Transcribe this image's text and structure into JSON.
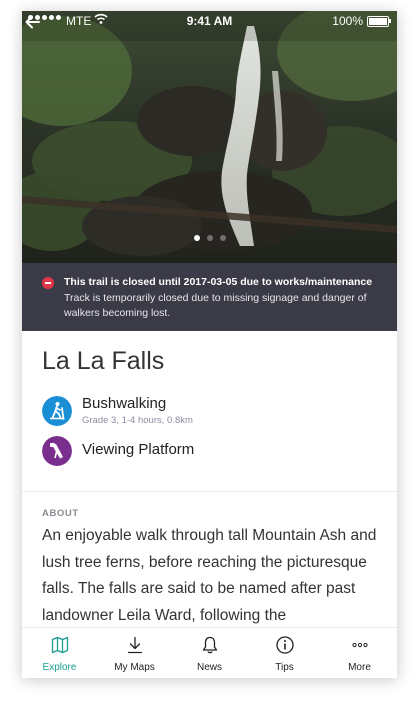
{
  "status_bar": {
    "carrier": "MTE",
    "time": "9:41 AM",
    "battery": "100%"
  },
  "hero": {
    "slide_count": 3,
    "active_slide": 1
  },
  "alert": {
    "title": "This trail is closed until 2017-03-05 due to works/maintenance",
    "body": "Track is temporarily closed due to missing signage and danger of walkers becoming lost.",
    "color": "#e0364a"
  },
  "place": {
    "title": "La La Falls"
  },
  "activities": [
    {
      "name": "Bushwalking",
      "detail": "Grade 3, 1-4 hours, 0.8km",
      "icon": "hiker-icon",
      "color": "#1a8fd6"
    },
    {
      "name": "Viewing Platform",
      "detail": "",
      "icon": "binoculars-icon",
      "color": "#7a2f8f"
    }
  ],
  "about": {
    "label": "ABOUT",
    "text": "An enjoyable walk through tall Mountain Ash and lush tree ferns, before reaching the picturesque falls.  The falls are said to be named after past landowner Leila Ward, following the subdivision..."
  },
  "tabs": [
    {
      "label": "Explore",
      "icon": "map-icon",
      "active": true
    },
    {
      "label": "My Maps",
      "icon": "download-icon",
      "active": false
    },
    {
      "label": "News",
      "icon": "bell-icon",
      "active": false
    },
    {
      "label": "Tips",
      "icon": "info-icon",
      "active": false
    },
    {
      "label": "More",
      "icon": "more-icon",
      "active": false
    }
  ],
  "colors": {
    "accent": "#1a9e8f",
    "alert_background": "#3a3b46"
  }
}
